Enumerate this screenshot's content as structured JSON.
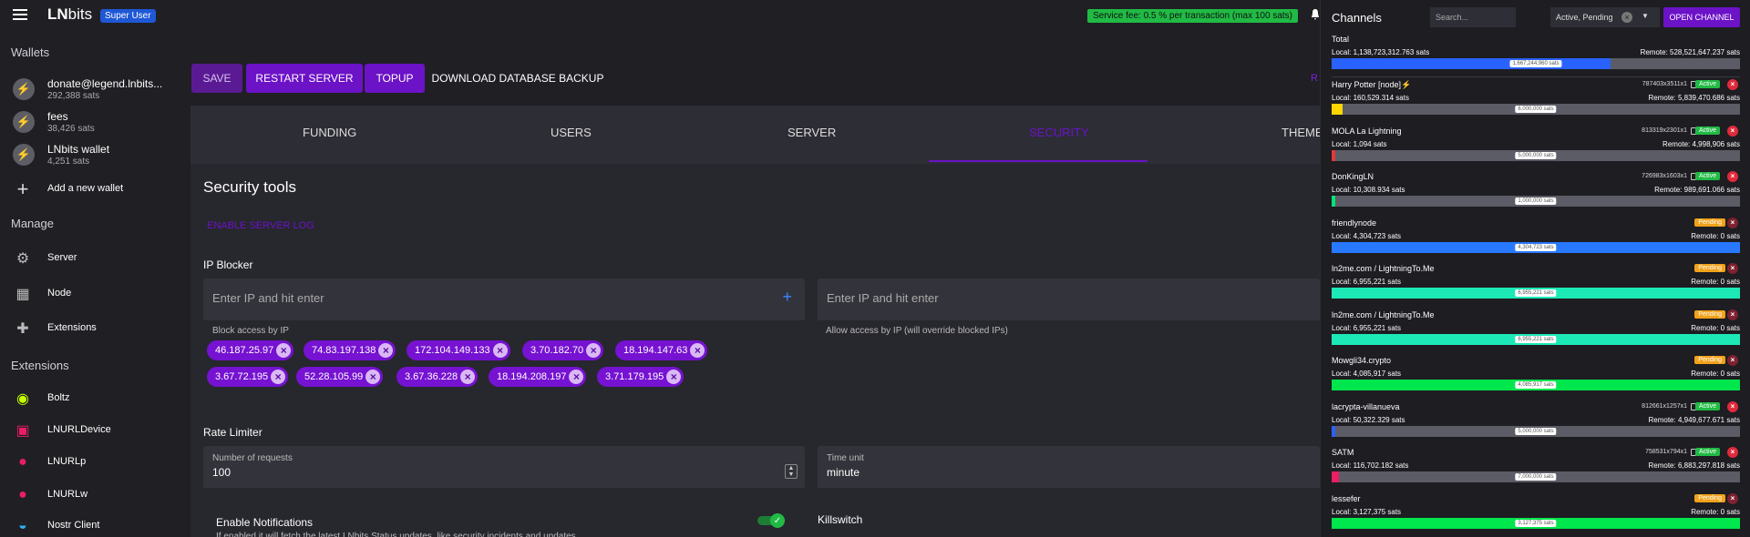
{
  "header": {
    "brand_prefix": "LN",
    "brand_suffix": "bits",
    "role_badge": "Super User",
    "service_fee": "Service fee: 0.5 % per transaction (max 100 sats)"
  },
  "sidebar": {
    "wallets_title": "Wallets",
    "wallets": [
      {
        "name": "donate@legend.lnbits...",
        "sats": "292,388 sats"
      },
      {
        "name": "fees",
        "sats": "38,426 sats"
      },
      {
        "name": "LNbits wallet",
        "sats": "4,251 sats"
      }
    ],
    "add_wallet": "Add a new wallet",
    "manage_title": "Manage",
    "manage": [
      "Server",
      "Node",
      "Extensions"
    ],
    "extensions_title": "Extensions",
    "extensions": [
      "Boltz",
      "LNURLDevice",
      "LNURLp",
      "LNURLw",
      "Nostr Client"
    ]
  },
  "actions": {
    "save": "Save",
    "restart": "Restart Server",
    "topup": "Topup",
    "download": "Download Database Backup",
    "r_fragment": "R"
  },
  "tabs": [
    "Funding",
    "Users",
    "Server",
    "Security",
    "Theme"
  ],
  "security": {
    "title": "Security tools",
    "enable_log": "Enable Server Log",
    "ip_blocker_title": "IP Blocker",
    "block_placeholder": "Enter IP and hit enter",
    "allow_placeholder": "Enter IP and hit enter",
    "block_hint": "Block access by IP",
    "allow_hint": "Allow access by IP (will override blocked IPs)",
    "blocked_ips": [
      "46.187.25.97",
      "74.83.197.138",
      "172.104.149.133",
      "3.70.182.70",
      "18.194.147.63",
      "3.67.72.195",
      "52.28.105.99",
      "3.67.36.228",
      "18.194.208.197",
      "3.71.179.195"
    ],
    "rate_limiter_title": "Rate Limiter",
    "requests_label": "Number of requests",
    "requests_value": "100",
    "time_unit_label": "Time unit",
    "time_unit_value": "minute",
    "notifications_title": "Enable Notifications",
    "notifications_sub": "If enabled it will fetch the latest LNbits Status updates, like security incidents and updates.",
    "killswitch_title": "Killswitch"
  },
  "channels": {
    "title": "Channels",
    "search_placeholder": "Search...",
    "filter_value": "Active, Pending",
    "open_button": "Open Channel",
    "total": {
      "name": "Total",
      "local": "Local: 1,138,723,312.763 sats",
      "remote": "Remote: 528,521,647.237 sats",
      "capacity": "1,667,244,960 sats",
      "fill": 0.683,
      "color": "#2962ff"
    },
    "list": [
      {
        "name": "Harry Potter [node]⚡",
        "id": "787403x3511x1",
        "status": "Active",
        "local": "Local: 160,529.314 sats",
        "remote": "Remote: 5,839,470.686 sats",
        "capacity": "6,000,000 sats",
        "fill": 0.027,
        "color": "#ffd600"
      },
      {
        "name": "MOLA La Lightning",
        "id": "813319x2301x1",
        "status": "Active",
        "local": "Local: 1,094 sats",
        "remote": "Remote: 4,998,906 sats",
        "capacity": "5,000,000 sats",
        "fill": 0.0,
        "color": "#e53935"
      },
      {
        "name": "DonKingLN",
        "id": "726983x1603x1",
        "status": "Active",
        "local": "Local: 10,308.934 sats",
        "remote": "Remote: 989,691.066 sats",
        "capacity": "1,000,000 sats",
        "fill": 0.01,
        "color": "#00e676"
      },
      {
        "name": "friendlynode",
        "id": "",
        "status": "Pending",
        "local": "Local: 4,304,723 sats",
        "remote": "Remote: 0 sats",
        "capacity": "4,304,723 sats",
        "fill": 1.0,
        "color": "#2979ff"
      },
      {
        "name": "ln2me.com / LightningTo.Me",
        "id": "",
        "status": "Pending",
        "local": "Local: 6,955,221 sats",
        "remote": "Remote: 0 sats",
        "capacity": "6,955,221 sats",
        "fill": 1.0,
        "color": "#1de9b6"
      },
      {
        "name": "ln2me.com / LightningTo.Me",
        "id": "",
        "status": "Pending",
        "local": "Local: 6,955,221 sats",
        "remote": "Remote: 0 sats",
        "capacity": "6,955,221 sats",
        "fill": 1.0,
        "color": "#1de9b6"
      },
      {
        "name": "Mowgli34.crypto",
        "id": "",
        "status": "Pending",
        "local": "Local: 4,085,917 sats",
        "remote": "Remote: 0 sats",
        "capacity": "4,085,917 sats",
        "fill": 1.0,
        "color": "#00e64d"
      },
      {
        "name": "lacrypta-villanueva",
        "id": "812661x1257x1",
        "status": "Active",
        "local": "Local: 50,322.329 sats",
        "remote": "Remote: 4,949,677.671 sats",
        "capacity": "5,000,000 sats",
        "fill": 0.01,
        "color": "#2962ff"
      },
      {
        "name": "SATM",
        "id": "758531x794x1",
        "status": "Active",
        "local": "Local: 116,702.182 sats",
        "remote": "Remote: 6,883,297.818 sats",
        "capacity": "7,000,000 sats",
        "fill": 0.017,
        "color": "#e91e63"
      },
      {
        "name": "lessefer",
        "id": "",
        "status": "Pending",
        "local": "Local: 3,127,375 sats",
        "remote": "Remote: 0 sats",
        "capacity": "3,127,375 sats",
        "fill": 1.0,
        "color": "#00e64d"
      }
    ]
  }
}
